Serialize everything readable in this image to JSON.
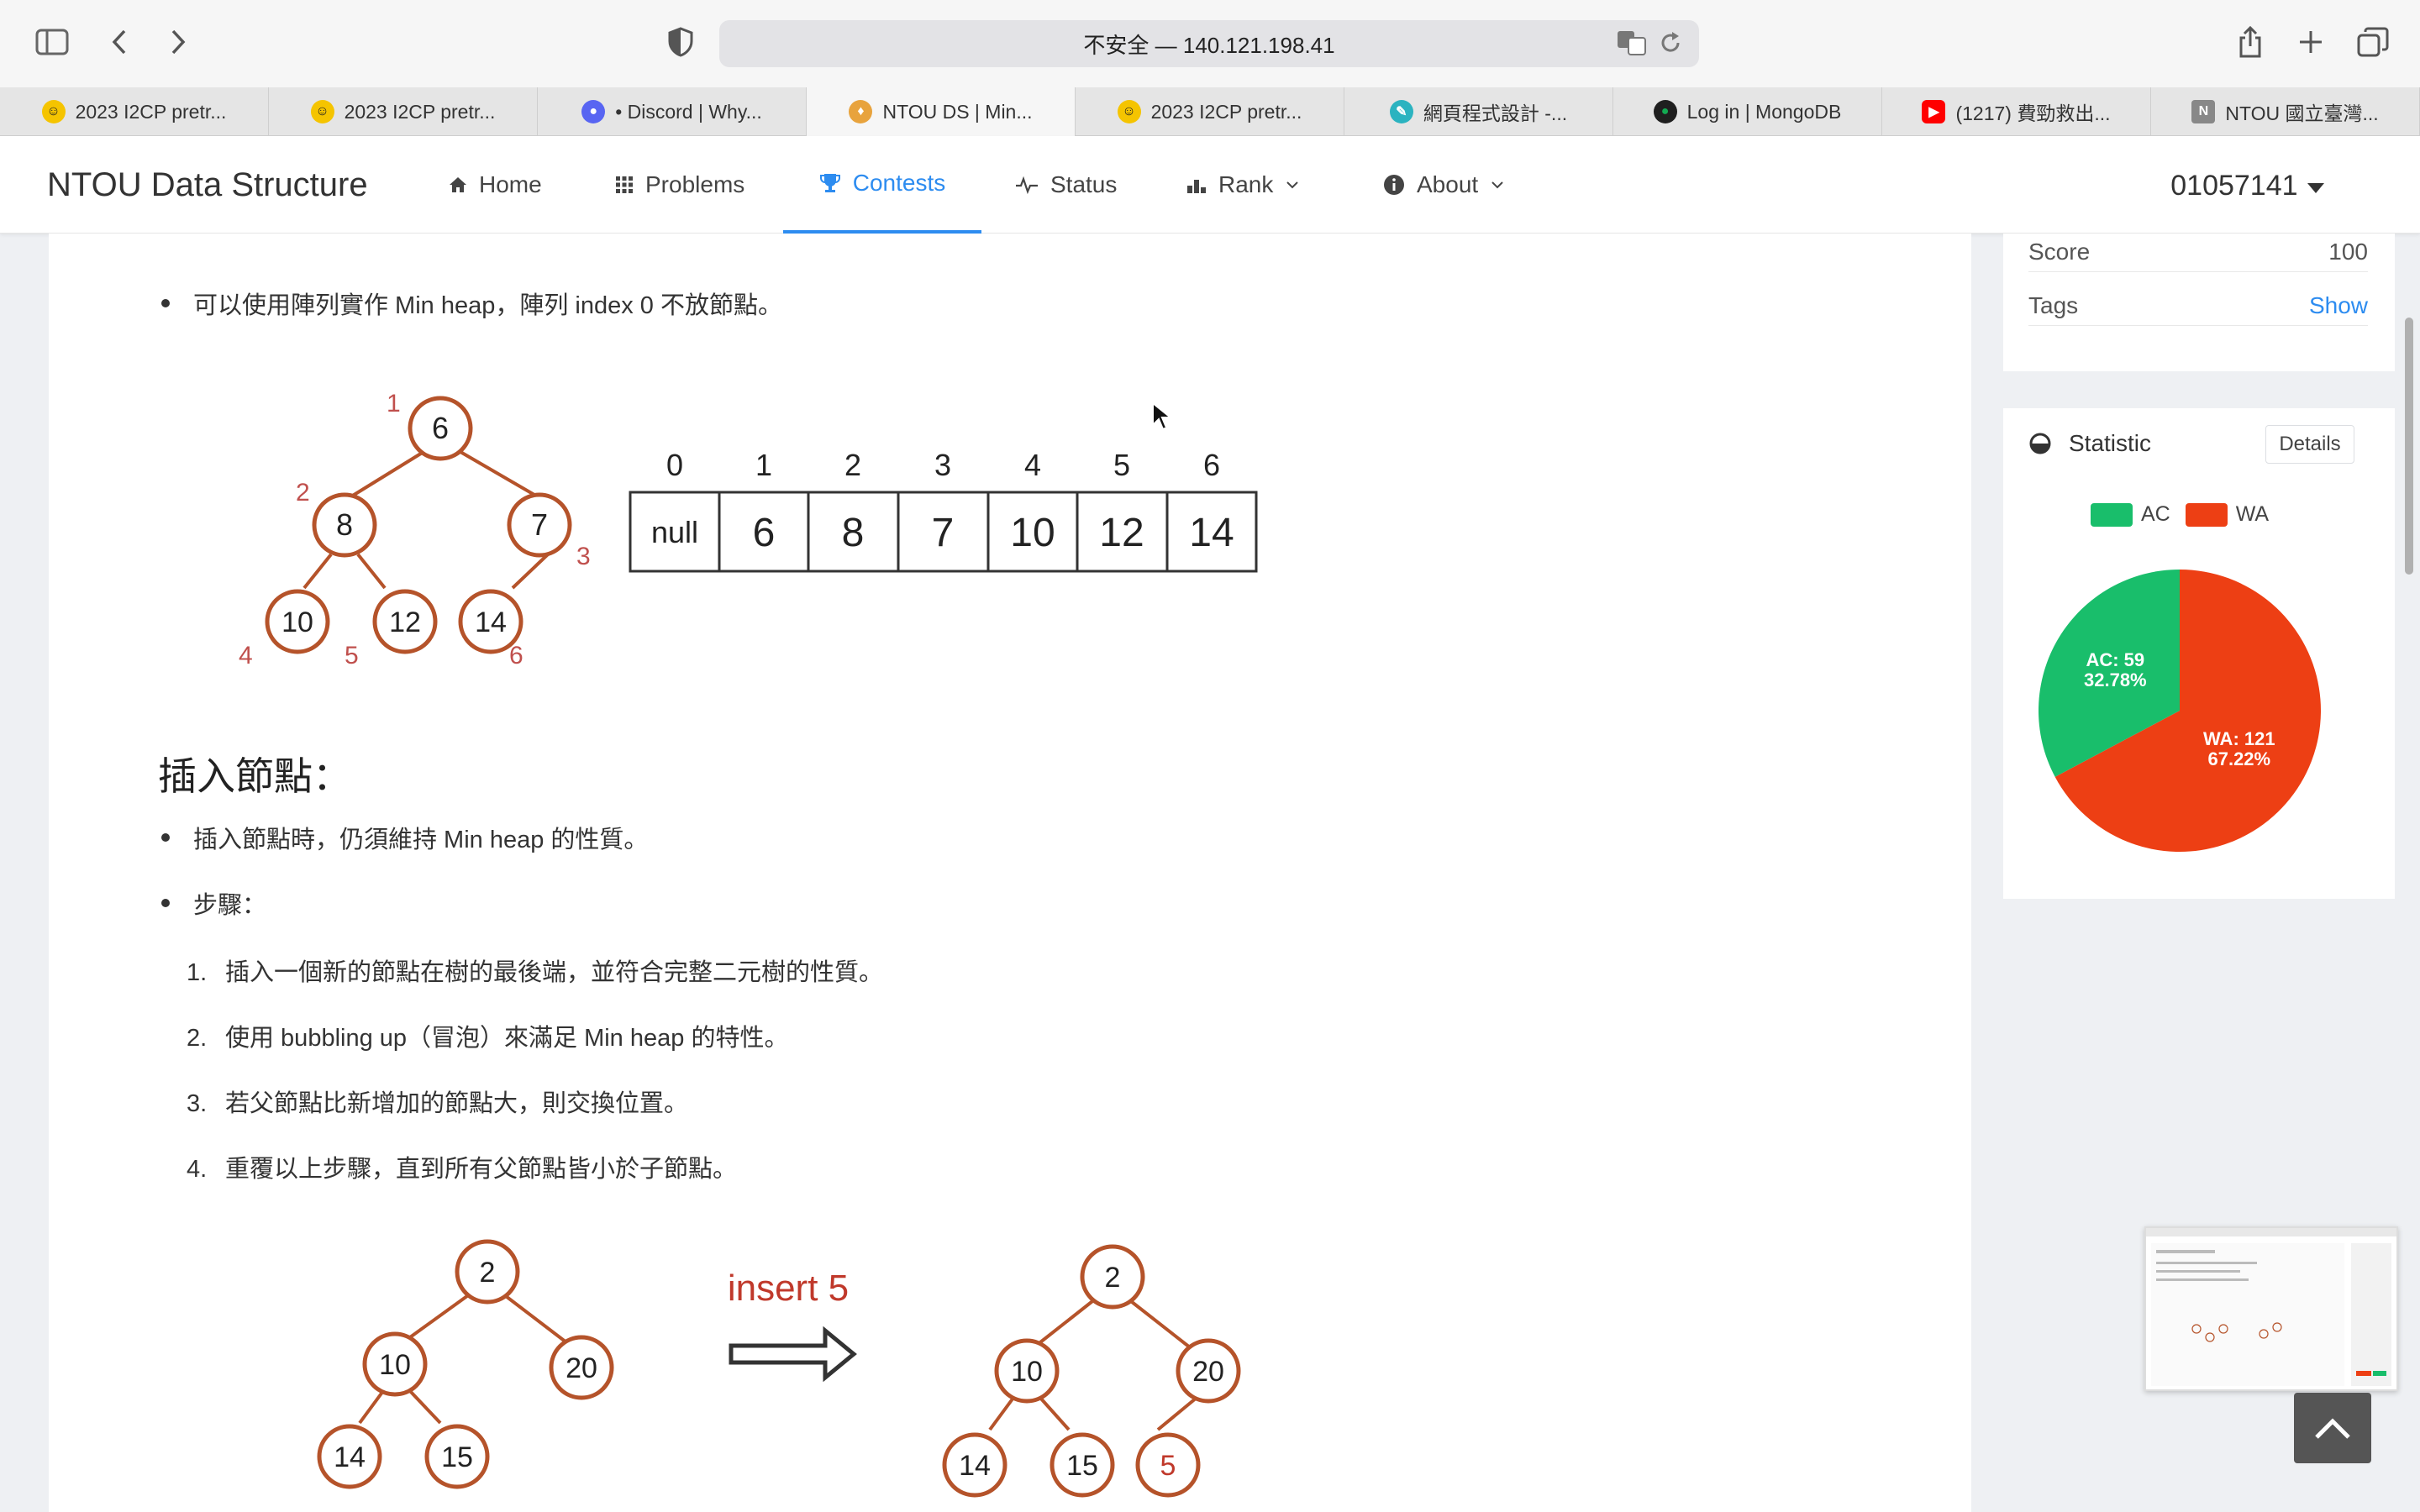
{
  "browser": {
    "address_text": "不安全 — 140.121.198.41",
    "tabs": [
      {
        "label": "2023 I2CP pretr...",
        "icon": "smiley-icon"
      },
      {
        "label": "2023 I2CP pretr...",
        "icon": "smiley-icon"
      },
      {
        "label": "• Discord | Why...",
        "icon": "discord-icon"
      },
      {
        "label": "NTOU DS | Min...",
        "icon": "ntou-icon",
        "active": true
      },
      {
        "label": "2023 I2CP pretr...",
        "icon": "smiley-icon"
      },
      {
        "label": "網頁程式設計 -...",
        "icon": "pen-icon"
      },
      {
        "label": "Log in | MongoDB",
        "icon": "mongodb-icon"
      },
      {
        "label": "(1217) 費勁救出...",
        "icon": "youtube-icon"
      },
      {
        "label": "NTOU 國立臺灣...",
        "icon": "notion-icon"
      }
    ]
  },
  "site": {
    "brand": "NTOU Data Structure",
    "nav": {
      "home": "Home",
      "problems": "Problems",
      "contests": "Contests",
      "status": "Status",
      "rank": "Rank",
      "about": "About"
    },
    "user": "01057141"
  },
  "content": {
    "bullet_array": "可以使用陣列實作 Min heap，陣列 index 0 不放節點。",
    "array_indices": [
      "0",
      "1",
      "2",
      "3",
      "4",
      "5",
      "6"
    ],
    "array_values": [
      "null",
      "6",
      "8",
      "7",
      "10",
      "12",
      "14"
    ],
    "tree1": {
      "nodes": [
        "6",
        "8",
        "7",
        "10",
        "12",
        "14"
      ],
      "indices": [
        "1",
        "2",
        "3",
        "4",
        "5",
        "6"
      ]
    },
    "section_title": "插入節點：",
    "bullet_insert": "插入節點時，仍須維持 Min heap 的性質。",
    "bullet_steps": "步驟：",
    "steps": [
      {
        "num": "1.",
        "text": "插入一個新的節點在樹的最後端，並符合完整二元樹的性質。"
      },
      {
        "num": "2.",
        "text": "使用 bubbling up（冒泡）來滿足 Min heap 的特性。"
      },
      {
        "num": "3.",
        "text": "若父節點比新增加的節點大，則交換位置。"
      },
      {
        "num": "4.",
        "text": "重覆以上步驟，直到所有父節點皆小於子節點。"
      }
    ],
    "insert_before": [
      "2",
      "10",
      "20",
      "14",
      "15"
    ],
    "insert_label": "insert 5",
    "insert_after": [
      "2",
      "10",
      "20",
      "14",
      "15",
      "5"
    ]
  },
  "sidebar": {
    "score_label": "Score",
    "score_value": "100",
    "tags_label": "Tags",
    "tags_action": "Show",
    "statistic_title": "Statistic",
    "details_button": "Details",
    "legend_ac": "AC",
    "legend_wa": "WA",
    "label_ac_1": "AC: 59",
    "label_ac_2": "32.78%",
    "label_wa_1": "WA: 121",
    "label_wa_2": "67.22%"
  },
  "chart_data": {
    "type": "pie",
    "categories": [
      "AC",
      "WA"
    ],
    "values": [
      59,
      121
    ],
    "percentages": [
      32.78,
      67.22
    ],
    "colors": [
      "#19be6b",
      "#ed3f14"
    ],
    "legend": "top"
  }
}
